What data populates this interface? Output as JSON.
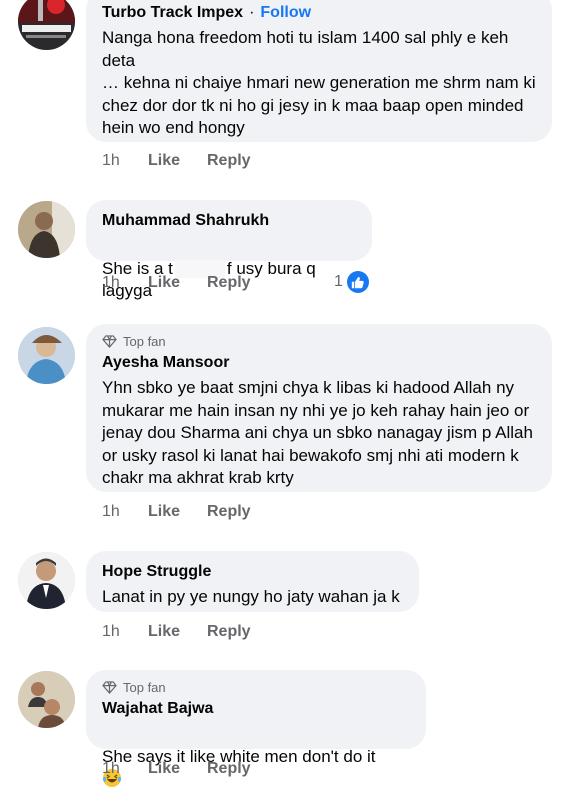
{
  "comments": [
    {
      "name": "Turbo Track Impex",
      "follow": "Follow",
      "separator": "·",
      "text": "Nanga hona freedom hoti tu islam 1400 sal phly e keh deta\n… kehna ni chaiye hmari new generation me shrm nam ki chez dor dor tk ni ho gi jesy in k maa baap open minded hein wo end hongy",
      "time": "1h",
      "like": "Like",
      "reply": "Reply",
      "avatar_icon": "turbotrack-logo"
    },
    {
      "name": "Muhammad Shahrukh",
      "text_before": "She is a t",
      "text_after": "f usy bura q lagyga",
      "time": "1h",
      "like": "Like",
      "reply": "Reply",
      "reaction_count": "1",
      "reaction_icon": "like-reaction-icon"
    },
    {
      "badge": "Top fan",
      "name": "Ayesha Mansoor",
      "text": "Yhn sbko ye baat smjni chya k libas ki hadood Allah ny mukarar me hain insan ny nhi ye jo keh rahay hain jeo or jenay dou Sharma ani chya un sbko nanagay jism p Allah or usky rasol ki lanat hai bewakofo smj nhi ati modern k chakr ma akhrat krab krty",
      "time": "1h",
      "like": "Like",
      "reply": "Reply"
    },
    {
      "name": "Hope Struggle",
      "text": "Lanat in py ye nungy ho jaty wahan ja k",
      "time": "1h",
      "like": "Like",
      "reply": "Reply"
    },
    {
      "badge": "Top fan",
      "name": "Wajahat Bajwa",
      "text": "She says it like white men don't do it",
      "emoji": "laughing-tears-emoji",
      "time": "1h",
      "like": "Like",
      "reply": "Reply"
    }
  ],
  "colors": {
    "bubble": "#f0f2f5",
    "link": "#1877f2",
    "meta": "#65676b"
  }
}
